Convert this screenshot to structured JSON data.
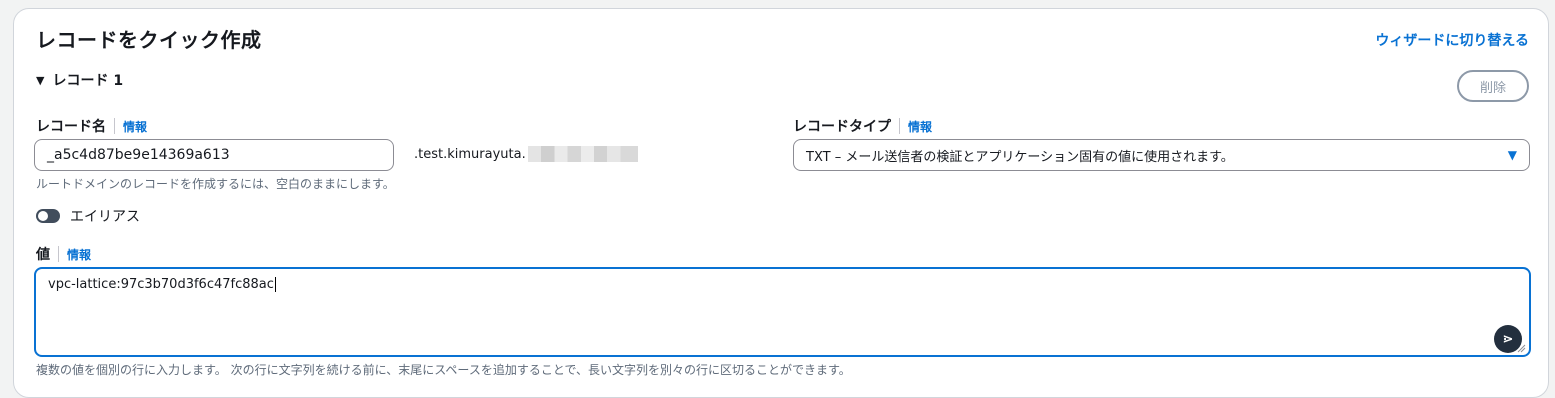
{
  "panel": {
    "title": "レコードをクイック作成",
    "switch_link": "ウィザードに切り替える"
  },
  "record": {
    "toggle_label": "レコード 1",
    "delete_label": "削除"
  },
  "record_name": {
    "label": "レコード名",
    "info": "情報",
    "value": "_a5c4d87be9e14369a613",
    "suffix": ".test.kimurayuta.",
    "hint": "ルートドメインのレコードを作成するには、空白のままにします。"
  },
  "record_type": {
    "label": "レコードタイプ",
    "info": "情報",
    "selected": "TXT – メール送信者の検証とアプリケーション固有の値に使用されます。"
  },
  "alias": {
    "label": "エイリアス",
    "enabled": false
  },
  "value_field": {
    "label": "値",
    "info": "情報",
    "value": "vpc-lattice:97c3b70d3f6c47fc88ac",
    "hint": "複数の値を個別の行に入力します。 次の行に文字列を続ける前に、末尾にスペースを追加することで、長い文字列を別々の行に区切ることができます。"
  },
  "icons": {
    "caret": "caret-down-icon",
    "select_arrow": "triangle-down-icon",
    "extension": "extension-logo-icon"
  }
}
